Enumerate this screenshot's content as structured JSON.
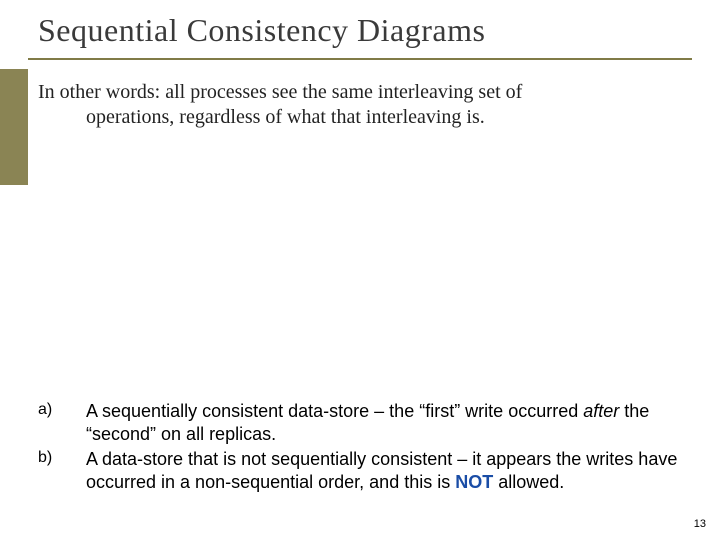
{
  "title": "Sequential Consistency Diagrams",
  "body_top_line1": "In other words: all processes see the same interleaving set of",
  "body_top_line2": "operations, regardless of what that interleaving is.",
  "items": {
    "a": {
      "marker": "a)",
      "pre": "A sequentially consistent data-store – the “first” write occurred ",
      "italic": "after",
      "post": " the “second” on all replicas."
    },
    "b": {
      "marker": "b)",
      "pre": "A data-store that is not sequentially consistent – it appears the writes have occurred in a non-sequential order, and this is ",
      "not": "NOT",
      "post": " allowed."
    }
  },
  "page_number": "13"
}
